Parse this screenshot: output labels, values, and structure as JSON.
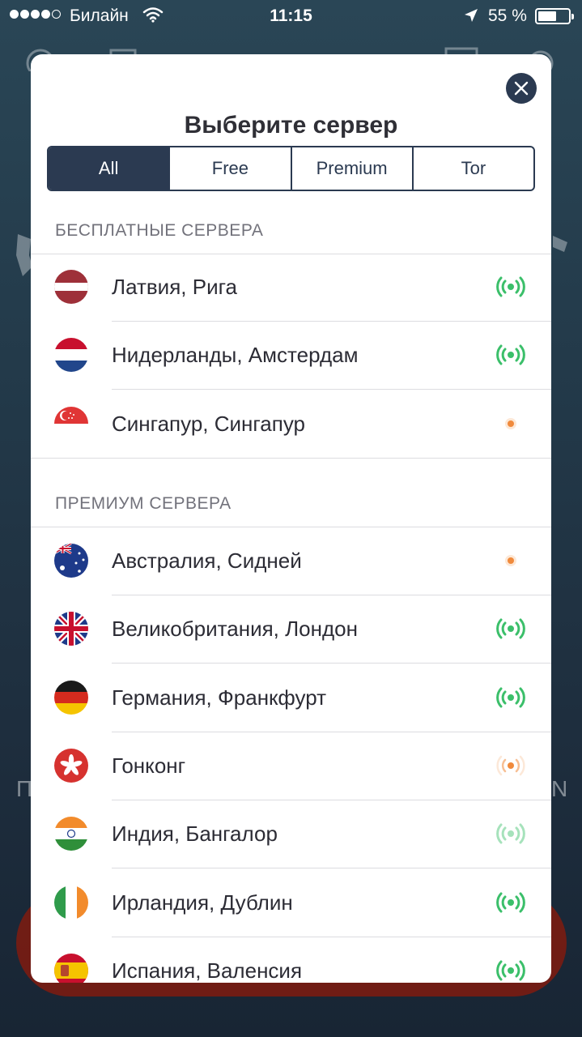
{
  "status_bar": {
    "carrier": "Билайн",
    "time": "11:15",
    "battery": "55 %"
  },
  "background": {
    "left_partial_text": "П",
    "right_partial_text": "N"
  },
  "modal": {
    "title": "Выберите сервер",
    "tabs": [
      "All",
      "Free",
      "Premium",
      "Tor"
    ],
    "active_tab": "All",
    "free_section": {
      "header": "БЕСПЛАТНЫЕ СЕРВЕРА",
      "servers": [
        {
          "name": "Латвия, Рига",
          "flag": "latvia",
          "status": "strong"
        },
        {
          "name": "Нидерланды, Амстердам",
          "flag": "netherlands",
          "status": "strong"
        },
        {
          "name": "Сингапур, Сингапур",
          "flag": "singapore",
          "status": "weak"
        }
      ]
    },
    "premium_section": {
      "header": "ПРЕМИУМ СЕРВЕРА",
      "servers": [
        {
          "name": "Австралия, Сидней",
          "flag": "australia",
          "status": "weak"
        },
        {
          "name": "Великобритания, Лондон",
          "flag": "uk",
          "status": "strong"
        },
        {
          "name": "Германия, Франкфурт",
          "flag": "germany",
          "status": "strong"
        },
        {
          "name": "Гонконг",
          "flag": "hong-kong",
          "status": "medium"
        },
        {
          "name": "Индия, Бангалор",
          "flag": "india",
          "status": "faded"
        },
        {
          "name": "Ирландия, Дублин",
          "flag": "ireland",
          "status": "strong"
        },
        {
          "name": "Испания, Валенсия",
          "flag": "spain",
          "status": "strong"
        }
      ]
    }
  },
  "colors": {
    "primary": "#2b3a51",
    "signal_green": "#3bbf6a",
    "signal_orange": "#f08a3c"
  }
}
